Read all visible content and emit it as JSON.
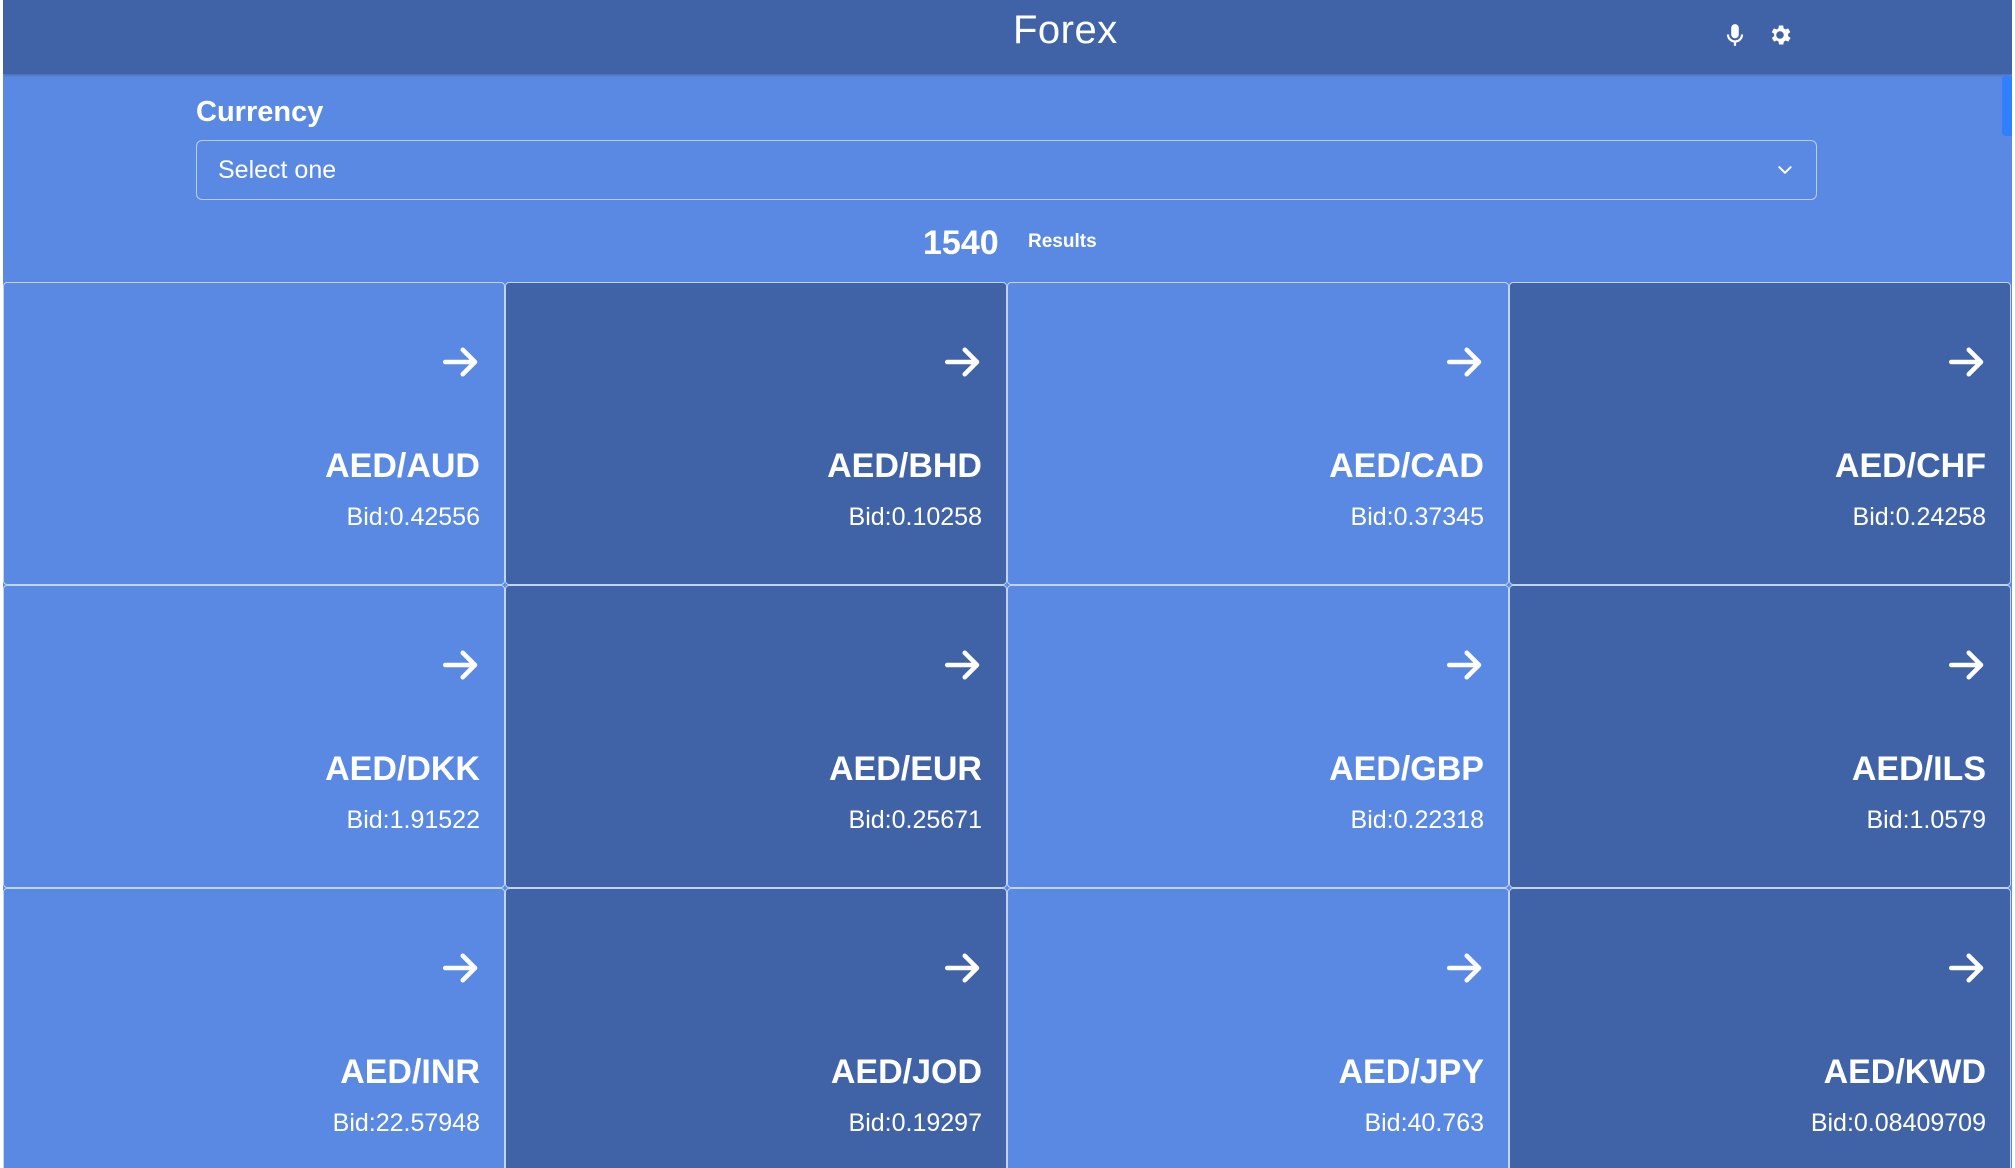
{
  "header": {
    "title": "Forex",
    "icons": [
      "microphone-icon",
      "gear-icon"
    ]
  },
  "filter": {
    "label": "Currency",
    "select_value": "Select one"
  },
  "results": {
    "count": "1540",
    "label": "Results"
  },
  "cards": [
    {
      "pair": "AED/AUD",
      "bid": "Bid:0.42556",
      "shade": "light"
    },
    {
      "pair": "AED/BHD",
      "bid": "Bid:0.10258",
      "shade": "dark"
    },
    {
      "pair": "AED/CAD",
      "bid": "Bid:0.37345",
      "shade": "light"
    },
    {
      "pair": "AED/CHF",
      "bid": "Bid:0.24258",
      "shade": "dark"
    },
    {
      "pair": "AED/DKK",
      "bid": "Bid:1.91522",
      "shade": "light"
    },
    {
      "pair": "AED/EUR",
      "bid": "Bid:0.25671",
      "shade": "dark"
    },
    {
      "pair": "AED/GBP",
      "bid": "Bid:0.22318",
      "shade": "light"
    },
    {
      "pair": "AED/ILS",
      "bid": "Bid:1.0579",
      "shade": "dark"
    },
    {
      "pair": "AED/INR",
      "bid": "Bid:22.57948",
      "shade": "light"
    },
    {
      "pair": "AED/JOD",
      "bid": "Bid:0.19297",
      "shade": "dark"
    },
    {
      "pair": "AED/JPY",
      "bid": "Bid:40.763",
      "shade": "light"
    },
    {
      "pair": "AED/KWD",
      "bid": "Bid:0.08409709",
      "shade": "dark"
    }
  ],
  "colors": {
    "header_bg": "#4063a7",
    "page_bg": "#5a89e3",
    "card_dark": "#4063a7",
    "card_light": "#5a89e3",
    "text": "#ffffff",
    "scroll_accent": "#2f7fff"
  }
}
